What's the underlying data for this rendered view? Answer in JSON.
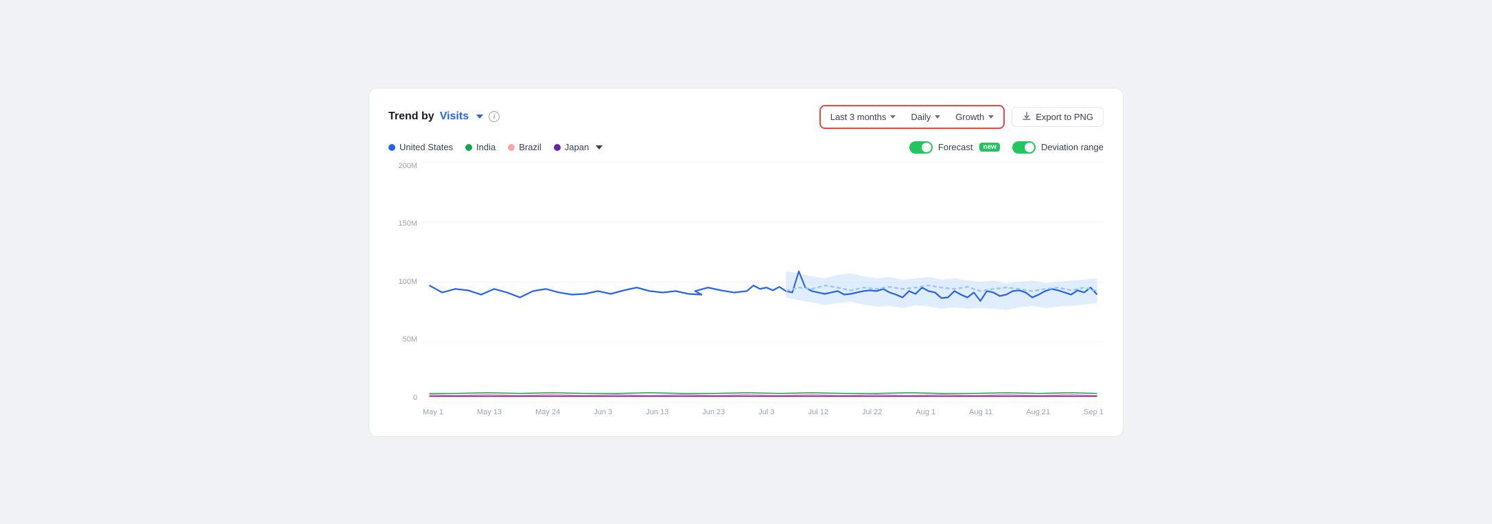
{
  "header": {
    "title_prefix": "Trend by",
    "title_metric": "Visits",
    "info_label": "i"
  },
  "filters": {
    "time_range_label": "Last 3 months",
    "frequency_label": "Daily",
    "metric_label": "Growth",
    "export_label": "Export to PNG"
  },
  "legend": {
    "items": [
      {
        "label": "United States",
        "color": "#2563eb"
      },
      {
        "label": "India",
        "color": "#16a34a"
      },
      {
        "label": "Brazil",
        "color": "#fca5a5"
      },
      {
        "label": "Japan",
        "color": "#6b21a8"
      }
    ],
    "japan_dropdown": true
  },
  "toggles": [
    {
      "label": "Forecast",
      "badge": "new",
      "enabled": true
    },
    {
      "label": "Deviation range",
      "badge": null,
      "enabled": true
    }
  ],
  "chart": {
    "y_labels": [
      "200M",
      "150M",
      "100M",
      "50M",
      "0"
    ],
    "x_labels": [
      "May 1",
      "May 13",
      "May 24",
      "Jun 3",
      "Jun 13",
      "Jun 23",
      "Jul 3",
      "Jul 12",
      "Jul 22",
      "Aug 1",
      "Aug 11",
      "Aug 21",
      "Sep 1"
    ],
    "colors": {
      "us_line": "#2563eb",
      "us_forecast": "#93c5fd",
      "india": "#16a34a",
      "brazil": "#f9a8d4",
      "japan": "#6b21a8"
    }
  }
}
